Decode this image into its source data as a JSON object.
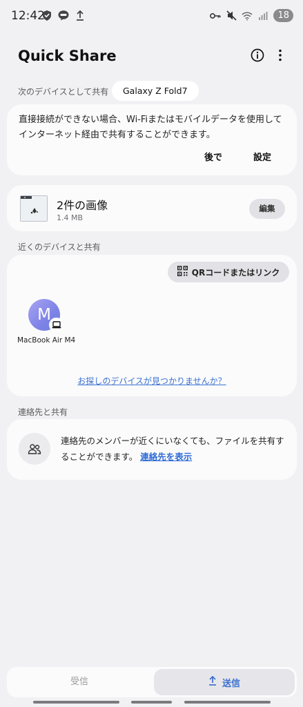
{
  "status_bar": {
    "time": "12:42",
    "battery": "18",
    "left_icons": [
      "shield-icon",
      "line-app-icon",
      "upload-icon"
    ],
    "right_icons": [
      "key-icon",
      "mute-icon",
      "wifi-icon",
      "signal-icon"
    ]
  },
  "header": {
    "title": "Quick Share",
    "icons": [
      "info-icon",
      "more-options-icon"
    ]
  },
  "share_as": {
    "label": "次のデバイスとして共有",
    "device_name": "Galaxy Z Fold7"
  },
  "connection_notice": {
    "text": "直接接続ができない場合、Wi-Fiまたはモバイルデータを使用してインターネット経由で共有することができます。",
    "later_label": "後で",
    "settings_label": "設定"
  },
  "file_card": {
    "title": "2件の画像",
    "size": "1.4 MB",
    "edit_label": "編集"
  },
  "nearby": {
    "label": "近くのデバイスと共有",
    "qr_button_label": "QRコードまたはリンク",
    "devices": [
      {
        "initial": "M",
        "name": "MacBook Air M4",
        "type_icon": "laptop-icon"
      }
    ],
    "not_found_link": "お探しのデバイスが見つかりませんか？"
  },
  "contacts": {
    "label": "連絡先と共有",
    "text": "連絡先のメンバーが近くにいなくても、ファイルを共有することができます。",
    "link": "連絡先を表示"
  },
  "bottom_tabs": {
    "receive": "受信",
    "send": "送信",
    "active": "send"
  },
  "colors": {
    "background": "#f1f1f4",
    "card": "#fbfbfc",
    "link": "#3a6fd0",
    "avatar_gradient": [
      "#a9a4f3",
      "#6f7ee0"
    ]
  }
}
